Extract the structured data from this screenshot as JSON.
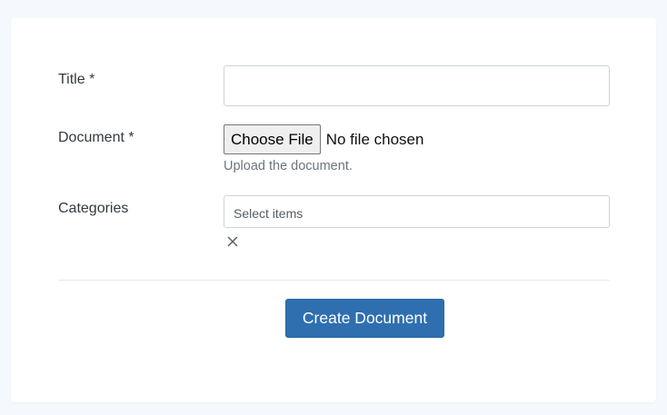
{
  "form": {
    "title": {
      "label": "Title *",
      "value": "",
      "placeholder": ""
    },
    "document": {
      "label": "Document *",
      "button_label": "Choose File",
      "status": "No file chosen",
      "help": "Upload the document."
    },
    "categories": {
      "label": "Categories",
      "placeholder": "Select items",
      "clear_icon": "close-icon"
    },
    "submit_label": "Create Document"
  },
  "colors": {
    "page_background": "#f5f8fc",
    "card_background": "#ffffff",
    "primary": "#2f6fb0",
    "border": "#ced4da",
    "muted_text": "#6c757d"
  }
}
